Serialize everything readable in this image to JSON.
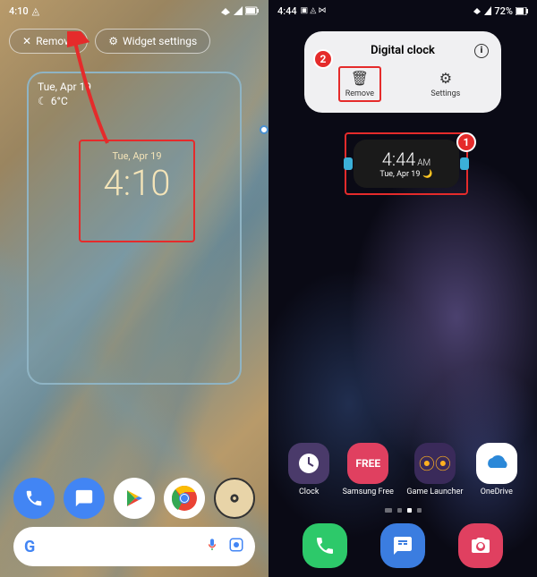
{
  "left": {
    "status": {
      "time": "4:10",
      "icons": "◬"
    },
    "buttons": {
      "remove": "Remove",
      "settings": "Widget settings"
    },
    "weather": {
      "date": "Tue, Apr 19",
      "temp": "6°C",
      "icon": "☾"
    },
    "clock": {
      "date": "Tue, Apr 19",
      "time": "4:10"
    },
    "search": {
      "placeholder": ""
    }
  },
  "right": {
    "status": {
      "time": "4:44",
      "icons": "▣ ◬ ⋈",
      "battery": "72%"
    },
    "popup": {
      "title": "Digital clock",
      "remove": "Remove",
      "settings": "Settings"
    },
    "callouts": {
      "one": "1",
      "two": "2"
    },
    "widget": {
      "time": "4:44",
      "ampm": "AM",
      "date": "Tue, Apr 19",
      "moon": "🌙"
    },
    "apps": {
      "clock": "Clock",
      "free": "Samsung Free",
      "free_icon": "FREE",
      "game": "Game Launcher",
      "onedrive": "OneDrive"
    }
  }
}
